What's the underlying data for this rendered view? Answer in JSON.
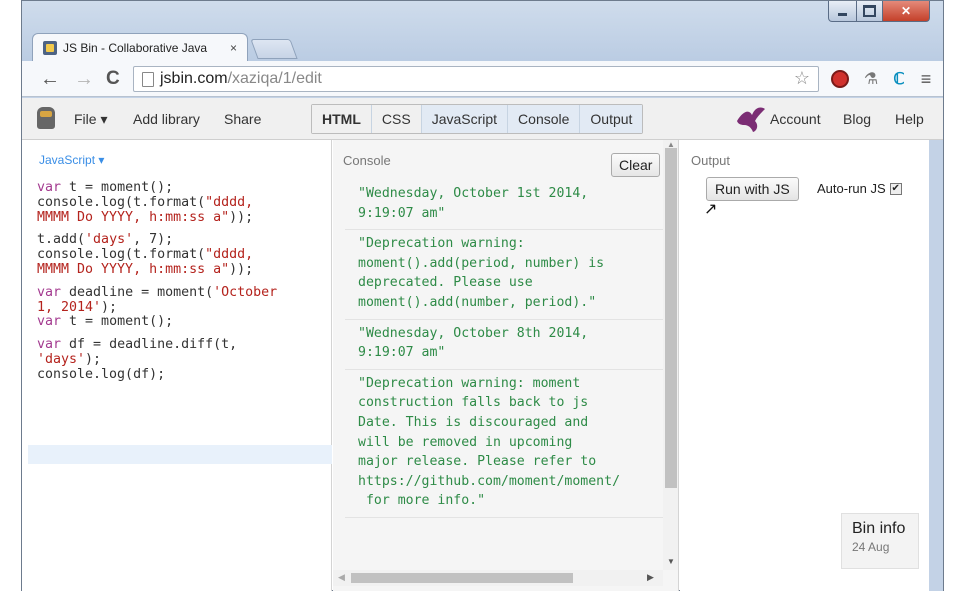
{
  "browser": {
    "tab_title": "JS Bin - Collaborative Java",
    "tab_close": "×",
    "url_host": "jsbin.com",
    "url_path": "/xaziqa/1/edit",
    "back": "←",
    "forward": "→",
    "reload": "C",
    "star": "☆",
    "menu": "≡"
  },
  "jsbin_nav": {
    "file": "File ▾",
    "add_library": "Add library",
    "share": "Share",
    "panels": [
      "HTML",
      "CSS",
      "JavaScript",
      "Console",
      "Output"
    ],
    "account": "Account",
    "blog": "Blog",
    "help": "Help"
  },
  "js_panel": {
    "label": "JavaScript ▾"
  },
  "console_panel": {
    "label": "Console",
    "clear": "Clear",
    "entries": [
      "\"Wednesday, October 1st 2014,\n9:19:07 am\"",
      "\"Deprecation warning:\nmoment().add(period, number) is\ndeprecated. Please use\nmoment().add(number, period).\"",
      "\"Wednesday, October 8th 2014,\n9:19:07 am\"",
      "\"Deprecation warning: moment\nconstruction falls back to js\nDate. This is discouraged and\nwill be removed in upcoming\nmajor release. Please refer to\nhttps://github.com/moment/moment/\n for more info.\""
    ]
  },
  "output_panel": {
    "label": "Output",
    "run_button": "Run with JS",
    "autorun": "Auto-run JS",
    "autorun_checked": true,
    "bin_info_title": "Bin info",
    "bin_info_date": "24 Aug"
  },
  "icons": {
    "adblock": "adblock-icon",
    "wand": "wand-icon",
    "ext_c": "extension-c-icon"
  },
  "colors": {
    "keyword": "#a33a8f",
    "string": "#b4231d",
    "console_text": "#2e8b47",
    "js_label": "#3a8ee6"
  }
}
